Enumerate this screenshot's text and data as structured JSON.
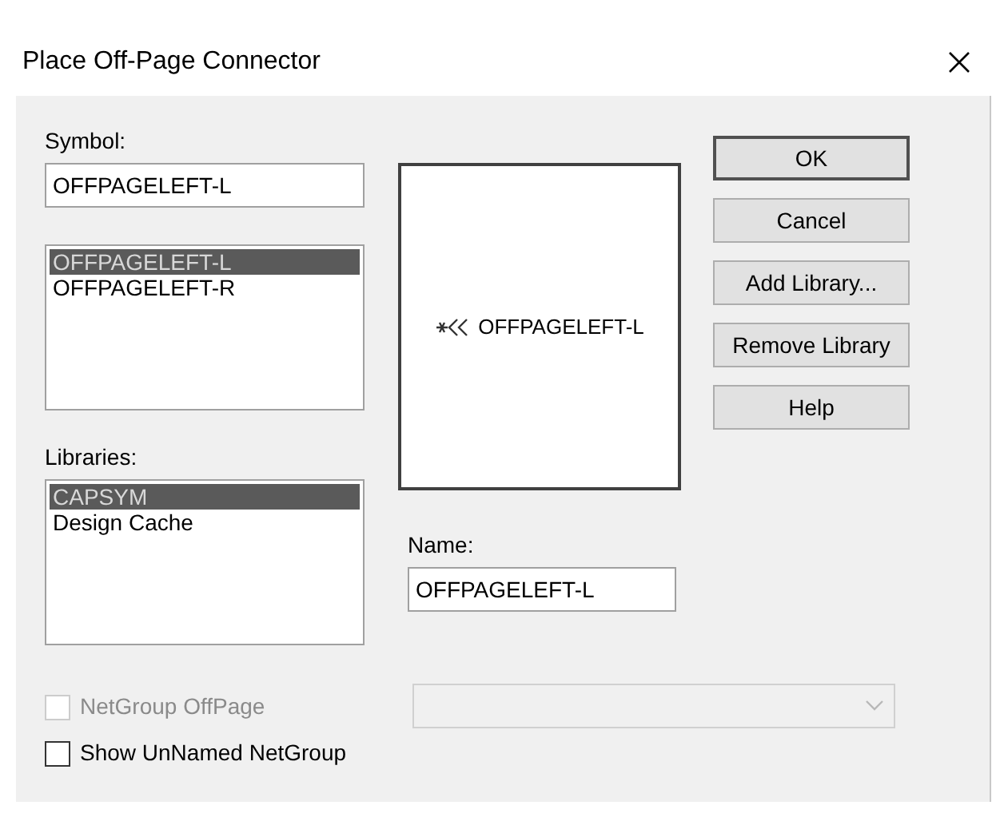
{
  "window": {
    "title": "Place Off-Page Connector"
  },
  "symbol": {
    "label": "Symbol:",
    "value": "OFFPAGELEFT-L"
  },
  "symbol_list": [
    {
      "label": "OFFPAGELEFT-L",
      "selected": true
    },
    {
      "label": "OFFPAGELEFT-R",
      "selected": false
    }
  ],
  "libraries": {
    "label": "Libraries:",
    "items": [
      {
        "label": "CAPSYM",
        "selected": true
      },
      {
        "label": "Design Cache",
        "selected": false
      }
    ]
  },
  "preview": {
    "text": "OFFPAGELEFT-L"
  },
  "name": {
    "label": "Name:",
    "value": "OFFPAGELEFT-L"
  },
  "buttons": [
    {
      "label": "OK",
      "default": true
    },
    {
      "label": "Cancel",
      "default": false
    },
    {
      "label": "Add Library...",
      "default": false
    },
    {
      "label": "Remove Library",
      "default": false
    },
    {
      "label": "Help",
      "default": false
    }
  ],
  "checkboxes": [
    {
      "label": "NetGroup OffPage",
      "checked": false,
      "disabled": true
    },
    {
      "label": "Show UnNamed NetGroup",
      "checked": false,
      "disabled": false
    }
  ],
  "netgroup_dropdown": {
    "disabled": true
  }
}
